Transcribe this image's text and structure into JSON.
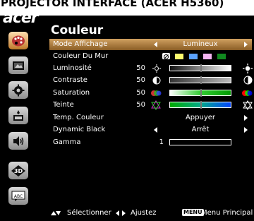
{
  "caption": "PROJECTOR INTERFACE (ACER H5360)",
  "brand": "acer",
  "sidebar": [
    {
      "name": "palette-icon",
      "active": true
    },
    {
      "name": "picture-icon",
      "active": false
    },
    {
      "name": "gear-icon",
      "active": false
    },
    {
      "name": "timer-icon",
      "active": false
    },
    {
      "name": "speaker-icon",
      "active": false
    },
    {
      "name": "3d-icon",
      "active": false
    },
    {
      "name": "abc-icon",
      "active": false
    }
  ],
  "menu": {
    "title": "Couleur",
    "rows": [
      {
        "label": "Mode Affichage",
        "value": "Lumineux",
        "selected": true
      },
      {
        "label": "Couleur Du Mur",
        "swatches": [
          "#fbfb6e",
          "#5aa2ff",
          "#f4b5f2",
          "#10891f"
        ]
      },
      {
        "label": "Luminosité",
        "num": "50",
        "level": 0.5
      },
      {
        "label": "Contraste",
        "num": "50",
        "level": 0.5
      },
      {
        "label": "Saturation",
        "num": "50",
        "level": 0.5
      },
      {
        "label": "Teinte",
        "num": "50",
        "level": 0.5
      },
      {
        "label": "Temp. Couleur",
        "value": "Appuyer"
      },
      {
        "label": "Dynamic Black",
        "value": "Arrêt"
      },
      {
        "label": "Gamma",
        "num": "1",
        "level": 0.0
      }
    ]
  },
  "footer": {
    "select": "Sélectionner",
    "adjust": "Ajustez",
    "menu_key": "MENU",
    "menu_label": "Menu Principal"
  }
}
